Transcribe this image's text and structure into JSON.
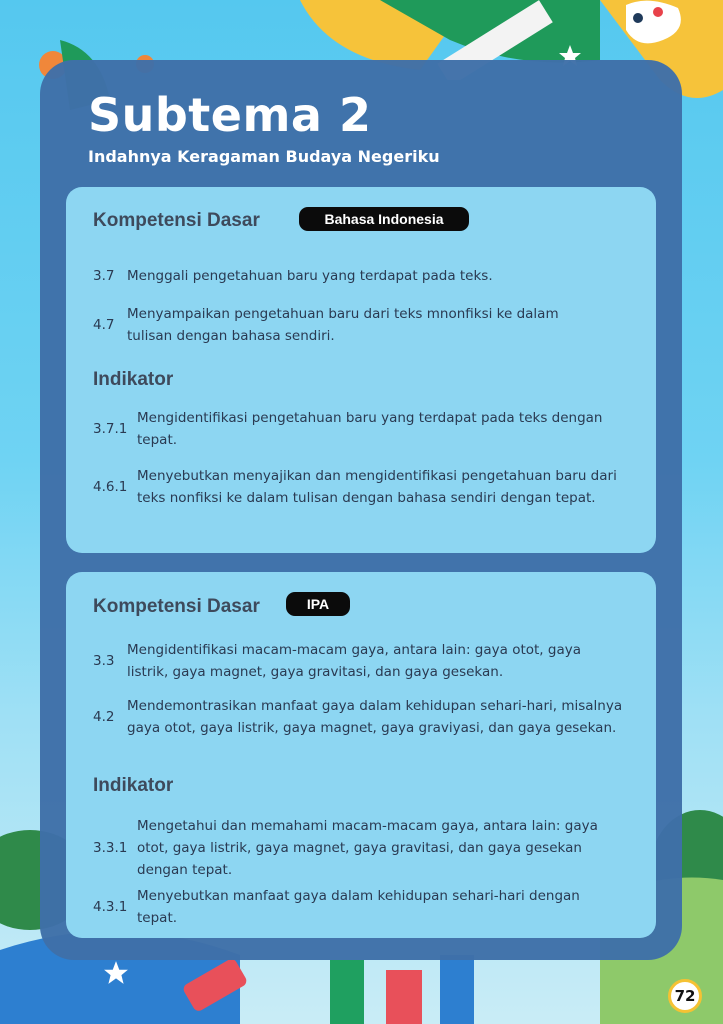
{
  "title": "Subtema 2",
  "subtitle": "Indahnya Keragaman Budaya Negeriku",
  "card1": {
    "kd_heading": "Kompetensi Dasar",
    "subject": "Bahasa Indonesia",
    "kd_items": [
      {
        "num": "3.7",
        "text": "Menggali pengetahuan baru yang terdapat pada teks."
      },
      {
        "num": "4.7",
        "text": "Menyampaikan pengetahuan baru dari teks mnonfiksi ke dalam tulisan dengan bahasa sendiri."
      }
    ],
    "ind_heading": "Indikator",
    "ind_items": [
      {
        "num": "3.7.1",
        "text": "Mengidentifikasi pengetahuan baru yang terdapat pada teks dengan tepat."
      },
      {
        "num": "4.6.1",
        "text": "Menyebutkan menyajikan dan mengidentifikasi pengetahuan baru dari teks nonfiksi ke dalam tulisan dengan bahasa sendiri dengan tepat."
      }
    ]
  },
  "card2": {
    "kd_heading": "Kompetensi Dasar",
    "subject": "IPA",
    "kd_items": [
      {
        "num": "3.3",
        "text": "Mengidentifikasi macam-macam gaya, antara lain: gaya otot, gaya listrik, gaya magnet, gaya gravitasi, dan gaya gesekan."
      },
      {
        "num": "4.2",
        "text": "Mendemontrasikan manfaat gaya dalam kehidupan sehari-hari, misalnya gaya otot, gaya listrik, gaya magnet, gaya graviyasi, dan gaya gesekan."
      }
    ],
    "ind_heading": "Indikator",
    "ind_items": [
      {
        "num": "3.3.1",
        "text": "Mengetahui dan memahami macam-macam gaya, antara lain: gaya otot, gaya listrik, gaya magnet, gaya gravitasi, dan gaya gesekan dengan tepat."
      },
      {
        "num": "4.3.1",
        "text": "Menyebutkan manfaat gaya dalam kehidupan sehari-hari dengan tepat."
      }
    ]
  },
  "page_number": "72",
  "colors": {
    "background": "#55c8ef",
    "panel": "#3f70a8",
    "card": "#8dd6f2",
    "pill": "#0b0b0b",
    "heading_text": "#3e4a5c"
  }
}
